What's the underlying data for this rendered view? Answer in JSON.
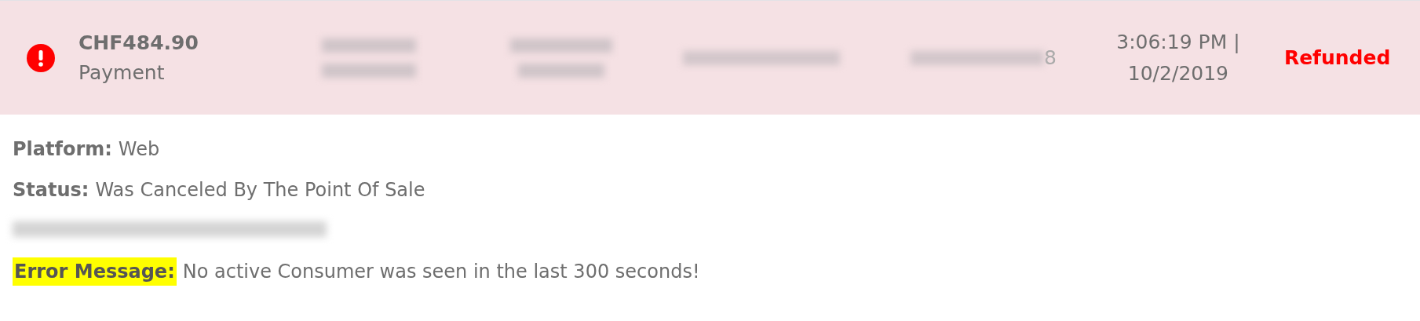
{
  "transaction": {
    "kind": "error",
    "amount": "CHF484.90",
    "type": "Payment",
    "id_fragment": "8",
    "time": "3:06:19 PM |",
    "date": "10/2/2019",
    "state": "Refunded"
  },
  "details": [
    {
      "kind": "field",
      "label": "Platform:",
      "value": "Web",
      "highlighted": false
    },
    {
      "kind": "field",
      "label": "Status:",
      "value": "Was Canceled By The Point Of Sale",
      "highlighted": false
    },
    {
      "kind": "redacted"
    },
    {
      "kind": "field",
      "label": "Error Message:",
      "value": "No active Consumer was seen in the last 300 seconds!",
      "highlighted": true
    }
  ]
}
